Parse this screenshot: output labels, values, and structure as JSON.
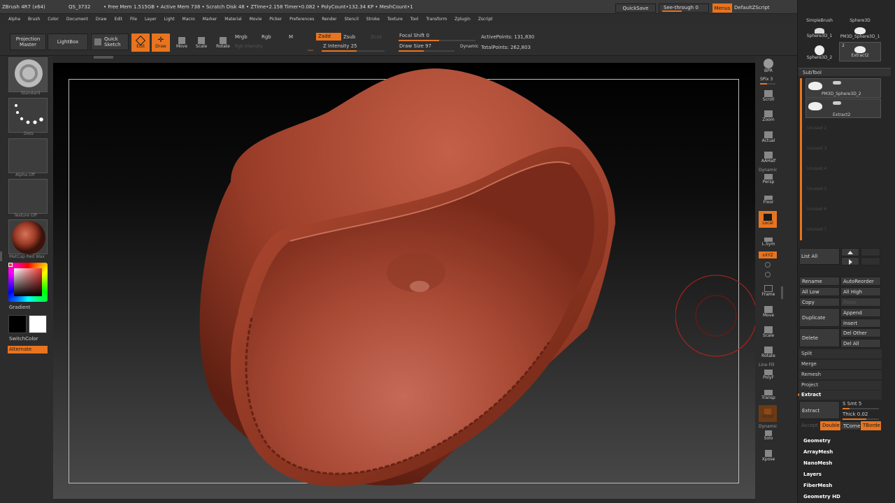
{
  "titlebar": {
    "app": "ZBrush 4R7 (x64)",
    "doc": "QS_3732",
    "stats": "• Free Mem 1.515GB • Active Mem 738 • Scratch Disk 48 • ZTime•2.158 Timer•0.082 • PolyCount•132.34 KP • MeshCount•1",
    "quicksave": "QuickSave",
    "seethrough": "See-through",
    "seethrough_val": "0",
    "menus": "Menus",
    "script": "DefaultZScript"
  },
  "menubar": [
    "Alpha",
    "Brush",
    "Color",
    "Document",
    "Draw",
    "Edit",
    "File",
    "Layer",
    "Light",
    "Macro",
    "Marker",
    "Material",
    "Movie",
    "Picker",
    "Preferences",
    "Render",
    "Stencil",
    "Stroke",
    "Texture",
    "Tool",
    "Transform",
    "Zplugin",
    "Zscript"
  ],
  "toolbar": {
    "projection_master": "Projection Master",
    "lightbox": "LightBox",
    "quick_sketch": "Quick Sketch",
    "edit": "Edit",
    "draw": "Draw",
    "move": "Move",
    "scale": "Scale",
    "rotate": "Rotate",
    "mrgb": "Mrgb",
    "rgb": "Rgb",
    "m": "M",
    "rgb_intensity": "Rgb Intensity",
    "zadd": "Zadd",
    "zsub": "Zsub",
    "zcut": "Zcut",
    "z_intensity": "Z Intensity 25",
    "focal_shift": "Focal Shift 0",
    "draw_size": "Draw Size 97",
    "dynamic": "Dynamic",
    "active_points": "ActivePoints: 131,830",
    "total_points": "TotalPoints: 262,803"
  },
  "left": {
    "brush": "Standard",
    "stroke": "Dots",
    "alpha": "Alpha Off",
    "texture": "Texture Off",
    "material": "MatCap Red Wax",
    "gradient": "Gradient",
    "switch": "SwitchColor",
    "alternate": "Alternate"
  },
  "shelf": {
    "bpr": "BPR",
    "spix": "SPix 3",
    "scroll": "Scroll",
    "zoom": "Zoom",
    "actual": "Actual",
    "aahalf": "AAHalf",
    "dynamic": "Dynamic",
    "persp": "Persp",
    "floor": "Floor",
    "local": "Local",
    "lsym": "L.Sym",
    "xyz": "xXYZ",
    "frame": "Frame",
    "move": "Move",
    "scale": "Scale",
    "rotate": "Rotate",
    "linefill": "Line Fill",
    "polyf": "PolyF",
    "transp": "Transp",
    "ghost": "Ghost",
    "dynamic2": "Dynamic",
    "solo": "Solo",
    "xpose": "Xpose"
  },
  "tray": {
    "tools": [
      {
        "label": "SimpleBrush"
      },
      {
        "label": "Sphere3D"
      },
      {
        "label": "Sphere3D_1"
      },
      {
        "label": "PM3D_Sphere3D_1"
      },
      {
        "label": "Sphere3D_2"
      },
      {
        "label": "Extract2",
        "badge": "2"
      }
    ],
    "subtool_header": "SubTool",
    "subtools": [
      "PM3D_Sphere3D_2",
      "Extract2"
    ],
    "unused": [
      "Unused 2",
      "Unused 3",
      "Unused 4",
      "Unused 5",
      "Unused 6",
      "Unused 7"
    ],
    "list_all": "List All",
    "rename": "Rename",
    "autoreorder": "AutoReorder",
    "all_low": "All Low",
    "all_high": "All High",
    "copy": "Copy",
    "paste": "Paste",
    "duplicate": "Duplicate",
    "append": "Append",
    "insert": "Insert",
    "delete": "Delete",
    "del_other": "Del Other",
    "del_all": "Del All",
    "split": "Split",
    "merge": "Merge",
    "remesh": "Remesh",
    "project": "Project",
    "extract_header": "Extract",
    "extract_btn": "Extract",
    "s_smt": "S Smt 5",
    "thick": "Thick 0.02",
    "accept": "Accept",
    "double": "Double",
    "tcorne": "TCorne",
    "tborde": "TBorde",
    "sections": [
      "Geometry",
      "ArrayMesh",
      "NanoMesh",
      "Layers",
      "FiberMesh",
      "Geometry HD"
    ]
  },
  "colors": {
    "accent": "#e8741f",
    "clay": "#a0412c",
    "panel": "#2c2c2c"
  }
}
